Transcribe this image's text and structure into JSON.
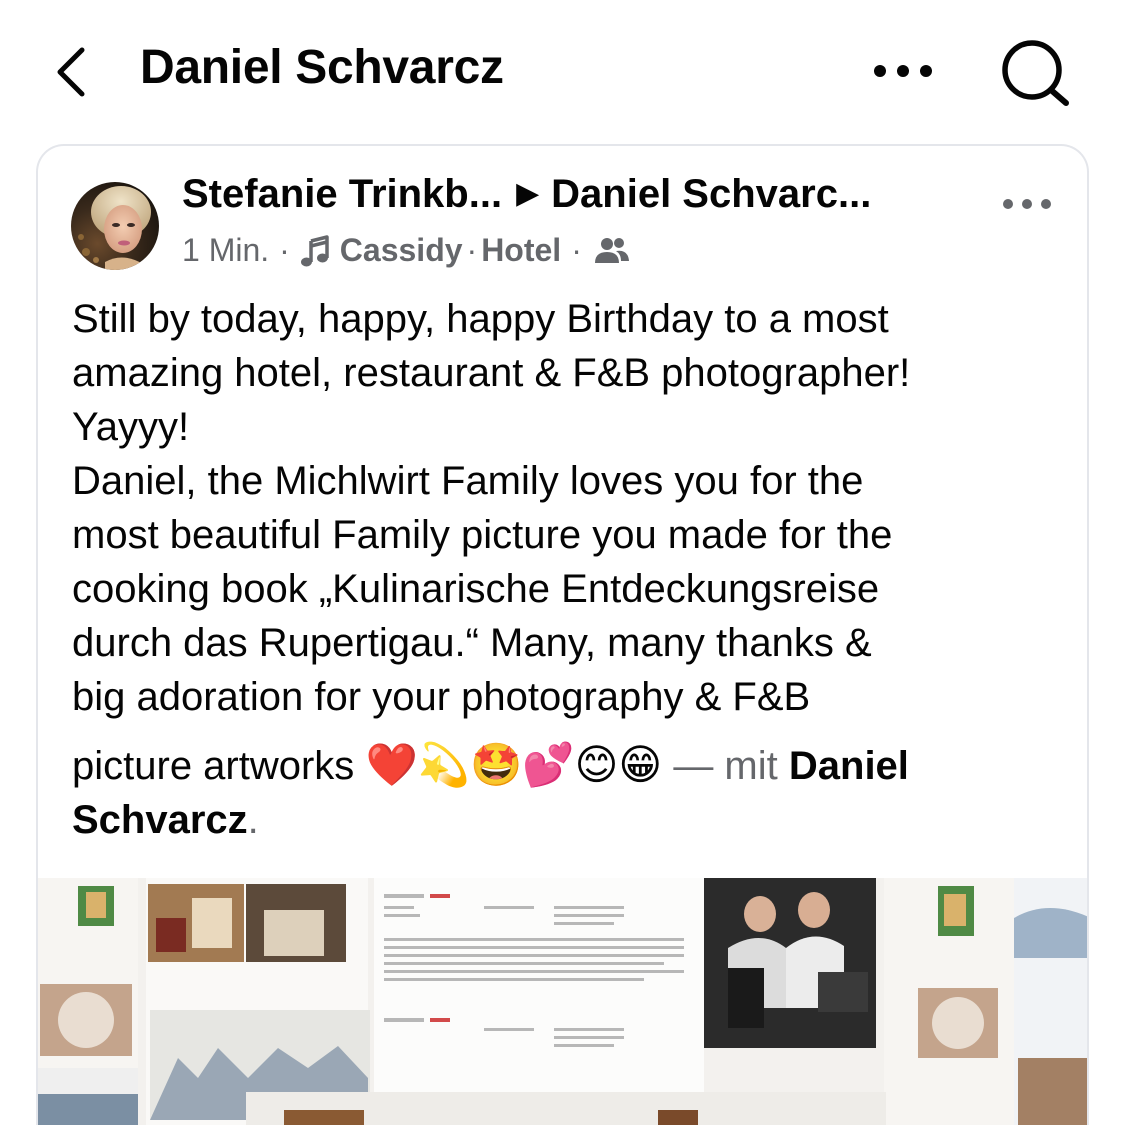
{
  "header": {
    "title": "Daniel Schvarcz",
    "back_icon": "chevron-left-icon",
    "more_icon": "more-horizontal-icon",
    "search_icon": "search-icon"
  },
  "post": {
    "author": "Stefanie Trinkb...",
    "target": "Daniel Schvarc...",
    "time": "1 Min.",
    "music": "Cassidy",
    "location": "Hotel",
    "audience_icon": "friends-icon",
    "text_lines": [
      "Still by today, happy, happy Birthday to a most",
      "amazing hotel, restaurant & F&B photographer!",
      "Yayyy!",
      "Daniel, the Michlwirt Family loves you for the",
      "most beautiful Family picture you made for the",
      "cooking book „Kulinarische Entdeckungsreise",
      "durch das Rupertigau.“ Many, many thanks &",
      "big adoration for your photography & F&B"
    ],
    "last_line_prefix": "picture artworks",
    "emojis": "❤️💫🤩💕😊😁",
    "with_text": "— mit",
    "tagged_first": "Daniel",
    "tagged_second": "Schvarcz",
    "period": "."
  }
}
